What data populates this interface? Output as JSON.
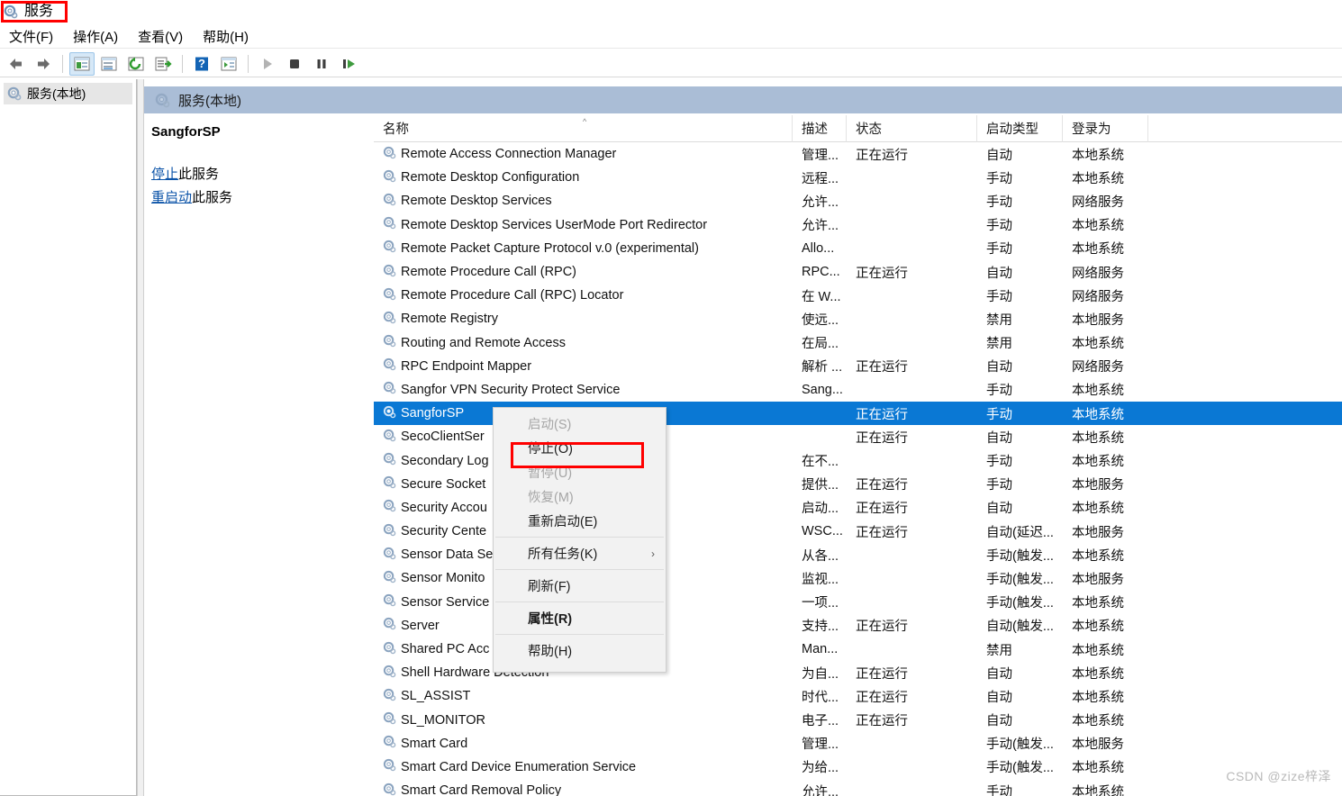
{
  "window": {
    "title": "服务",
    "title_icon": "services-gear-icon",
    "title_highlight_color": "#ff0000"
  },
  "menubar": {
    "items": [
      {
        "label": "文件(F)",
        "name": "menu-file"
      },
      {
        "label": "操作(A)",
        "name": "menu-action"
      },
      {
        "label": "查看(V)",
        "name": "menu-view"
      },
      {
        "label": "帮助(H)",
        "name": "menu-help"
      }
    ]
  },
  "toolbar": {
    "buttons": [
      {
        "icon": "back-arrow-icon",
        "name": "toolbar-back",
        "active": false
      },
      {
        "icon": "forward-arrow-icon",
        "name": "toolbar-forward",
        "active": false
      },
      {
        "icon": "show-hide-tree-icon",
        "name": "toolbar-show-tree",
        "active": true
      },
      {
        "icon": "properties-window-icon",
        "name": "toolbar-properties",
        "active": false
      },
      {
        "icon": "refresh-icon",
        "name": "toolbar-refresh",
        "active": false
      },
      {
        "icon": "export-list-icon",
        "name": "toolbar-export-list",
        "active": false
      },
      {
        "icon": "help-question-icon",
        "name": "toolbar-help",
        "active": false
      },
      {
        "icon": "show-action-pane-icon",
        "name": "toolbar-action-pane",
        "active": false
      },
      {
        "icon": "play-start-icon",
        "name": "toolbar-start-service",
        "active": false
      },
      {
        "icon": "stop-square-icon",
        "name": "toolbar-stop-service",
        "active": false
      },
      {
        "icon": "pause-bars-icon",
        "name": "toolbar-pause-service",
        "active": false
      },
      {
        "icon": "restart-icon",
        "name": "toolbar-restart-service",
        "active": false
      }
    ]
  },
  "tree": {
    "root_label": "服务(本地)",
    "root_icon": "services-gear-icon"
  },
  "pane_header": {
    "label": "服务(本地)",
    "icon": "services-gear-icon",
    "background": "#aabdd6"
  },
  "details": {
    "service_name": "SangforSP",
    "links": [
      {
        "link_text": "停止",
        "suffix": "此服务",
        "name": "stop-service-link"
      },
      {
        "link_text": "重启动",
        "suffix": "此服务",
        "name": "restart-service-link"
      }
    ],
    "link_color": "#0b53a8"
  },
  "list": {
    "columns": [
      {
        "label": "名称",
        "name": "column-name",
        "sorted": true,
        "sort_glyph": "^"
      },
      {
        "label": "描述",
        "name": "column-description"
      },
      {
        "label": "状态",
        "name": "column-status"
      },
      {
        "label": "启动类型",
        "name": "column-startup-type"
      },
      {
        "label": "登录为",
        "name": "column-log-on-as"
      }
    ],
    "selected_row_color": "#0a78d4",
    "rows": [
      {
        "name": "Remote Access Connection Manager",
        "desc": "管理...",
        "status": "正在运行",
        "startup": "自动",
        "logon": "本地系统",
        "selected": false
      },
      {
        "name": "Remote Desktop Configuration",
        "desc": "远程...",
        "status": "",
        "startup": "手动",
        "logon": "本地系统",
        "selected": false
      },
      {
        "name": "Remote Desktop Services",
        "desc": "允许...",
        "status": "",
        "startup": "手动",
        "logon": "网络服务",
        "selected": false
      },
      {
        "name": "Remote Desktop Services UserMode Port Redirector",
        "desc": "允许...",
        "status": "",
        "startup": "手动",
        "logon": "本地系统",
        "selected": false
      },
      {
        "name": "Remote Packet Capture Protocol v.0 (experimental)",
        "desc": "Allo...",
        "status": "",
        "startup": "手动",
        "logon": "本地系统",
        "selected": false
      },
      {
        "name": "Remote Procedure Call (RPC)",
        "desc": "RPC...",
        "status": "正在运行",
        "startup": "自动",
        "logon": "网络服务",
        "selected": false
      },
      {
        "name": "Remote Procedure Call (RPC) Locator",
        "desc": "在 W...",
        "status": "",
        "startup": "手动",
        "logon": "网络服务",
        "selected": false
      },
      {
        "name": "Remote Registry",
        "desc": "使远...",
        "status": "",
        "startup": "禁用",
        "logon": "本地服务",
        "selected": false
      },
      {
        "name": "Routing and Remote Access",
        "desc": "在局...",
        "status": "",
        "startup": "禁用",
        "logon": "本地系统",
        "selected": false
      },
      {
        "name": "RPC Endpoint Mapper",
        "desc": "解析 ...",
        "status": "正在运行",
        "startup": "自动",
        "logon": "网络服务",
        "selected": false
      },
      {
        "name": "Sangfor VPN Security Protect Service",
        "desc": "Sang...",
        "status": "",
        "startup": "手动",
        "logon": "本地系统",
        "selected": false
      },
      {
        "name": "SangforSP",
        "desc": "",
        "status": "正在运行",
        "startup": "手动",
        "logon": "本地系统",
        "selected": true
      },
      {
        "name": "SecoClientSer",
        "desc": "",
        "status": "正在运行",
        "startup": "自动",
        "logon": "本地系统",
        "selected": false
      },
      {
        "name": "Secondary Log",
        "desc": "在不...",
        "status": "",
        "startup": "手动",
        "logon": "本地系统",
        "selected": false
      },
      {
        "name": "Secure Socket",
        "desc": "提供...",
        "status": "正在运行",
        "startup": "手动",
        "logon": "本地服务",
        "selected": false
      },
      {
        "name": "Security Accou",
        "desc": "启动...",
        "status": "正在运行",
        "startup": "自动",
        "logon": "本地系统",
        "selected": false
      },
      {
        "name": "Security Cente",
        "desc": "WSC...",
        "status": "正在运行",
        "startup": "自动(延迟...",
        "logon": "本地服务",
        "selected": false
      },
      {
        "name": "Sensor Data Se",
        "desc": "从各...",
        "status": "",
        "startup": "手动(触发...",
        "logon": "本地系统",
        "selected": false
      },
      {
        "name": "Sensor Monito",
        "desc": "监视...",
        "status": "",
        "startup": "手动(触发...",
        "logon": "本地服务",
        "selected": false
      },
      {
        "name": "Sensor Service",
        "desc": "一项...",
        "status": "",
        "startup": "手动(触发...",
        "logon": "本地系统",
        "selected": false
      },
      {
        "name": "Server",
        "desc": "支持...",
        "status": "正在运行",
        "startup": "自动(触发...",
        "logon": "本地系统",
        "selected": false
      },
      {
        "name": "Shared PC Acc",
        "desc": "Man...",
        "status": "",
        "startup": "禁用",
        "logon": "本地系统",
        "selected": false
      },
      {
        "name": "Shell Hardware Detection",
        "desc": "为自...",
        "status": "正在运行",
        "startup": "自动",
        "logon": "本地系统",
        "selected": false
      },
      {
        "name": "SL_ASSIST",
        "desc": "时代...",
        "status": "正在运行",
        "startup": "自动",
        "logon": "本地系统",
        "selected": false
      },
      {
        "name": "SL_MONITOR",
        "desc": "电子...",
        "status": "正在运行",
        "startup": "自动",
        "logon": "本地系统",
        "selected": false
      },
      {
        "name": "Smart Card",
        "desc": "管理...",
        "status": "",
        "startup": "手动(触发...",
        "logon": "本地服务",
        "selected": false
      },
      {
        "name": "Smart Card Device Enumeration Service",
        "desc": "为给...",
        "status": "",
        "startup": "手动(触发...",
        "logon": "本地系统",
        "selected": false
      },
      {
        "name": "Smart Card Removal Policy",
        "desc": "允许...",
        "status": "",
        "startup": "手动",
        "logon": "本地系统",
        "selected": false
      }
    ]
  },
  "context_menu": {
    "highlight_color": "#ff0000",
    "items": [
      {
        "label": "启动(S)",
        "name": "ctx-start",
        "disabled": true,
        "bold": false,
        "submenu": false,
        "separator_after": false
      },
      {
        "label": "停止(O)",
        "name": "ctx-stop",
        "disabled": false,
        "bold": false,
        "submenu": false,
        "separator_after": false,
        "highlighted": true
      },
      {
        "label": "暂停(U)",
        "name": "ctx-pause",
        "disabled": true,
        "bold": false,
        "submenu": false,
        "separator_after": false
      },
      {
        "label": "恢复(M)",
        "name": "ctx-resume",
        "disabled": true,
        "bold": false,
        "submenu": false,
        "separator_after": false
      },
      {
        "label": "重新启动(E)",
        "name": "ctx-restart",
        "disabled": false,
        "bold": false,
        "submenu": false,
        "separator_after": true
      },
      {
        "label": "所有任务(K)",
        "name": "ctx-all-tasks",
        "disabled": false,
        "bold": false,
        "submenu": true,
        "separator_after": true
      },
      {
        "label": "刷新(F)",
        "name": "ctx-refresh",
        "disabled": false,
        "bold": false,
        "submenu": false,
        "separator_after": true
      },
      {
        "label": "属性(R)",
        "name": "ctx-properties",
        "disabled": false,
        "bold": true,
        "submenu": false,
        "separator_after": true
      },
      {
        "label": "帮助(H)",
        "name": "ctx-help",
        "disabled": false,
        "bold": false,
        "submenu": false,
        "separator_after": false
      }
    ]
  },
  "watermark": {
    "text": "CSDN @zize梓泽"
  }
}
